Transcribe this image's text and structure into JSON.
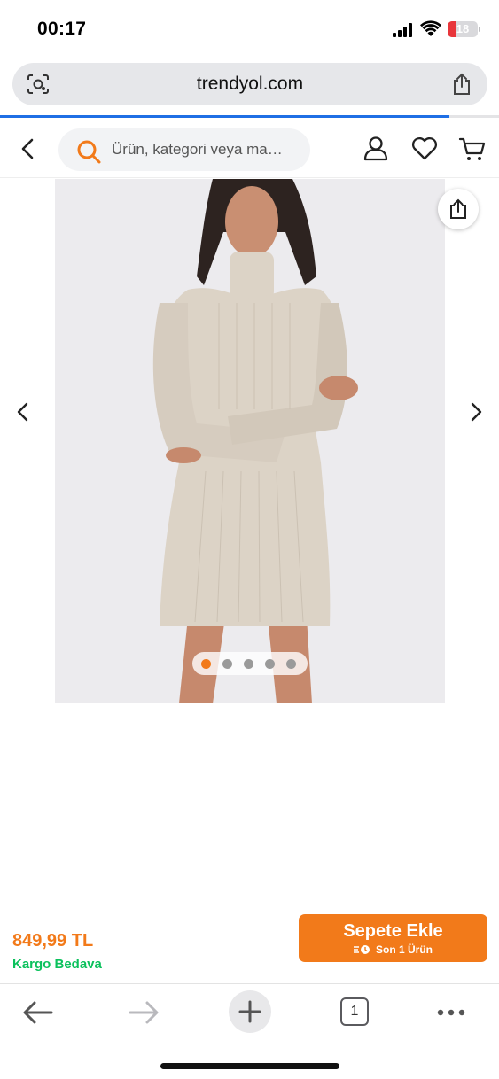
{
  "status_bar": {
    "time": "00:17",
    "battery_level": "18",
    "battery_color": "#e8363b"
  },
  "browser": {
    "url": "trendyol.com",
    "load_progress": 0.9,
    "progress_color": "#1f6fe5"
  },
  "header": {
    "search_placeholder": "Ürün, kategori veya ma…",
    "icons": [
      "back-icon",
      "search-icon",
      "user-icon",
      "heart-icon",
      "cart-icon"
    ]
  },
  "gallery": {
    "image_count": 5,
    "active_index": 0,
    "image_description": "product-photo-beige-ribbed-knit-dress"
  },
  "buy_bar": {
    "price": "849,99 TL",
    "shipping": "Kargo Bedava",
    "add_to_cart": "Sepete Ekle",
    "stock_note": "Son 1 Ürün",
    "accent_color": "#f27a1a",
    "shipping_color": "#0bc15c"
  },
  "toolbar": {
    "tab_count": "1",
    "icons": [
      "back-arrow-icon",
      "forward-arrow-icon",
      "new-tab-plus-icon",
      "tabs-icon",
      "more-icon"
    ]
  }
}
